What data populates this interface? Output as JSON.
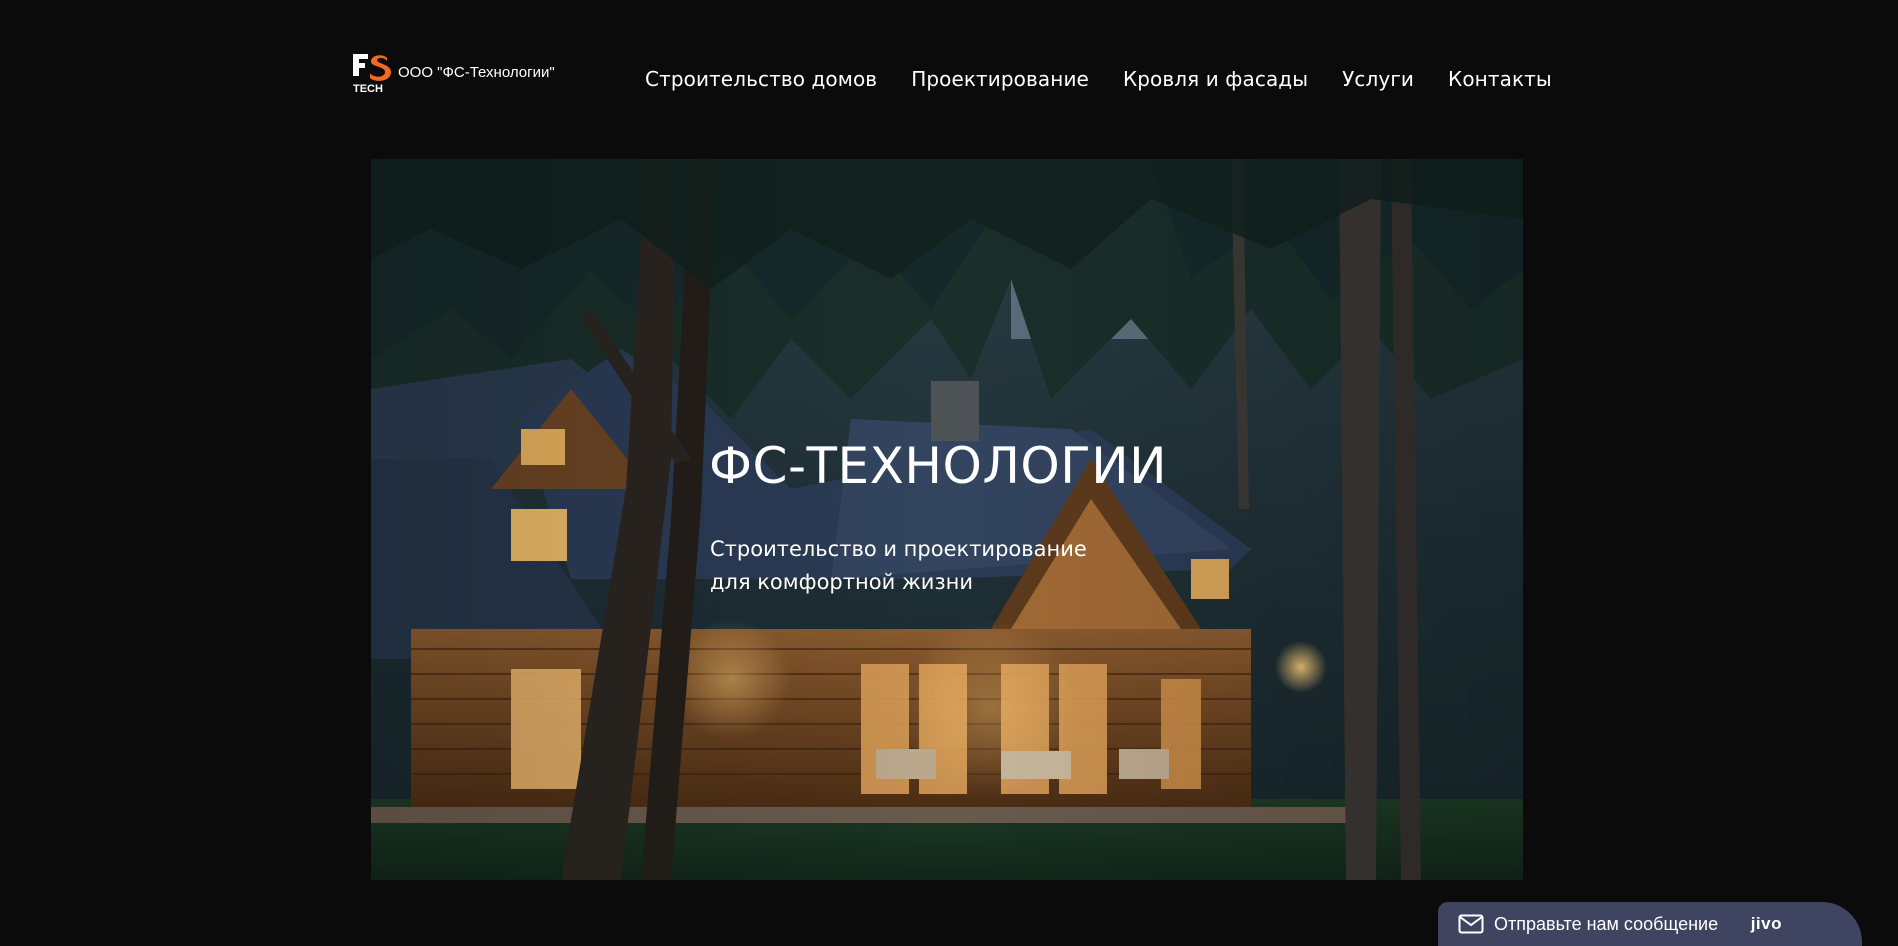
{
  "header": {
    "logo": {
      "mark_top": "FS",
      "mark_bottom": "TECH",
      "company_name": "ООО \"ФС-Технологии\""
    },
    "nav": [
      {
        "label": "Строительство домов"
      },
      {
        "label": "Проектирование"
      },
      {
        "label": "Кровля и фасады"
      },
      {
        "label": "Услуги"
      },
      {
        "label": "Контакты"
      }
    ]
  },
  "hero": {
    "title": "ФС-ТЕХНОЛОГИИ",
    "subtitle_line1": "Строительство и проектирование",
    "subtitle_line2": "для комфортной жизни"
  },
  "chat": {
    "label": "Отправьте нам сообщение",
    "brand": "jivo",
    "icon": "envelope-icon"
  },
  "colors": {
    "background": "#0b0b0b",
    "logo_accent": "#f26a21",
    "chat_bg": "#3f4560",
    "text": "#ffffff"
  }
}
